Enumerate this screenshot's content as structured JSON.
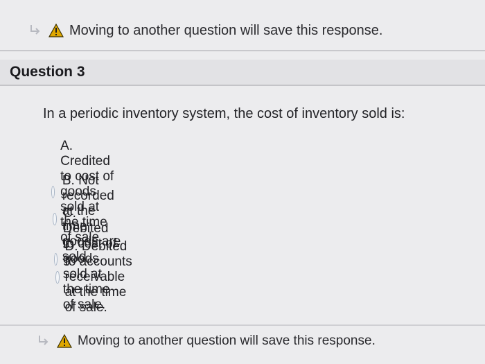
{
  "warning": {
    "top_text": "Moving to another question will save this response.",
    "bottom_text": "Moving to another question will save this response."
  },
  "question": {
    "title": "Question 3",
    "prompt": "In a periodic inventory system, the cost of inventory sold is:",
    "options": [
      {
        "label": "A. Credited to cost of goods sold at the time of sale."
      },
      {
        "label": "B. Not recorded at the time goods are sold."
      },
      {
        "label": "C. Debited to cost of goods sold at the time of sale."
      },
      {
        "label": "D. Debited to accounts receivable at the time of sale."
      }
    ]
  },
  "colors": {
    "background": "#ececee",
    "warning_icon": "#e0a800",
    "radio_border": "#a6b3c4"
  },
  "icons": {
    "nav": "arrow-right-icon",
    "warning": "warning-triangle-icon",
    "radio": "radio-unchecked-icon"
  }
}
